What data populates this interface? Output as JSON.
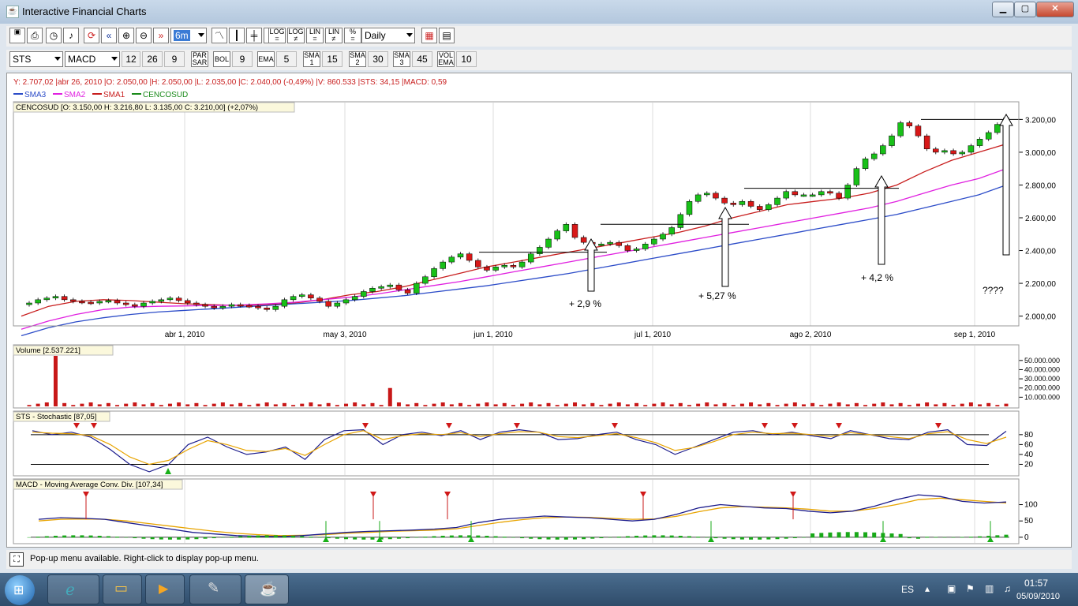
{
  "window": {
    "title": "Interactive Financial Charts",
    "app_icon": "java-icon",
    "controls": [
      "minimize-icon",
      "maximize-icon",
      "close-icon"
    ]
  },
  "toolbar1": {
    "period_value": "6m",
    "log_labels": [
      "LOG\n=",
      "LOG\n≠",
      "LIN\n=",
      "LIN\n≠",
      "%\n="
    ],
    "interval_value": "Daily"
  },
  "toolbar2": {
    "symbol": "STS",
    "indicator": "MACD",
    "macd_params": [
      "12",
      "26",
      "9"
    ],
    "par_sar_label": "PAR\nSAR",
    "bol_label": "BOL",
    "bol_value": "9",
    "ema_label": "EMA",
    "ema_value": "5",
    "sma1_label": "SMA\n1",
    "sma1_value": "15",
    "sma2_label": "SMA\n2",
    "sma2_value": "30",
    "sma3_label": "SMA\n3",
    "sma3_value": "45",
    "vol_label": "VOL\nEMA",
    "vol_value": "10"
  },
  "chart": {
    "info_line": "Y: 2.707,02 |abr 26, 2010 |O: 2.050,00 |H: 2.050,00 |L: 2.035,00 |C: 2.040,00 (-0,49%) |V: 860.533 |STS: 34,15 |MACD: 0,59",
    "legend": [
      {
        "name": "SMA3",
        "color": "#2c4cc8"
      },
      {
        "name": "SMA2",
        "color": "#e020e0"
      },
      {
        "name": "SMA1",
        "color": "#c81e1e"
      },
      {
        "name": "CENCOSUD",
        "color": "#1a8a1a"
      }
    ],
    "ohlc_label": "CENCOSUD [O: 3.150,00  H: 3.216,80  L: 3.135,00  C: 3.210,00] (+2,07%)",
    "volume_label": "Volume [2.537.221]",
    "sts_label": "STS - Stochastic [87,05]",
    "macd_label": "MACD - Moving Average Conv. Div. [107,34]",
    "annotations": [
      "+ 2,9 %",
      "+ 5,27 %",
      "+ 4,2 %",
      "????"
    ]
  },
  "chart_data": [
    {
      "type": "candlestick",
      "title": "CENCOSUD [O: 3.150,00  H: 3.216,80  L: 3.135,00  C: 3.210,00] (+2,07%)",
      "ylim": [
        1950,
        3250
      ],
      "x_ticks": [
        "abr 1, 2010",
        "may 3, 2010",
        "jun 1, 2010",
        "jul 1, 2010",
        "ago 2, 2010",
        "sep 1, 2010"
      ],
      "y_ticks": [
        "3.200,00",
        "3.000,00",
        "2.800,00",
        "2.600,00",
        "2.400,00",
        "2.200,00",
        "2.000,00"
      ],
      "close_series": [
        2080,
        2100,
        2110,
        2120,
        2100,
        2090,
        2085,
        2080,
        2090,
        2095,
        2080,
        2070,
        2060,
        2080,
        2090,
        2100,
        2110,
        2095,
        2080,
        2070,
        2060,
        2050,
        2060,
        2070,
        2065,
        2060,
        2050,
        2040,
        2060,
        2100,
        2120,
        2130,
        2110,
        2090,
        2060,
        2080,
        2100,
        2120,
        2150,
        2170,
        2180,
        2190,
        2160,
        2140,
        2200,
        2240,
        2290,
        2330,
        2360,
        2380,
        2340,
        2300,
        2280,
        2300,
        2310,
        2300,
        2330,
        2380,
        2420,
        2470,
        2520,
        2560,
        2480,
        2450,
        2440,
        2440,
        2450,
        2430,
        2400,
        2410,
        2440,
        2470,
        2500,
        2540,
        2620,
        2700,
        2740,
        2750,
        2720,
        2690,
        2680,
        2700,
        2670,
        2650,
        2680,
        2720,
        2760,
        2740,
        2740,
        2740,
        2760,
        2750,
        2720,
        2800,
        2900,
        2960,
        2990,
        3040,
        3100,
        3180,
        3160,
        3100,
        3020,
        3000,
        3010,
        2990,
        3000,
        3040,
        3080,
        3120,
        3170,
        3210
      ],
      "series": [
        {
          "name": "SMA1",
          "color": "#c81e1e",
          "values": [
            2000,
            2060,
            2090,
            2100,
            2095,
            2085,
            2075,
            2070,
            2065,
            2070,
            2080,
            2100,
            2130,
            2150,
            2180,
            2220,
            2260,
            2300,
            2330,
            2360,
            2390,
            2420,
            2450,
            2480,
            2510,
            2550,
            2600,
            2640,
            2680,
            2700,
            2720,
            2750,
            2800,
            2880,
            2950,
            3000,
            3050
          ]
        },
        {
          "name": "SMA2",
          "color": "#e020e0",
          "values": [
            1920,
            1970,
            2010,
            2040,
            2055,
            2060,
            2062,
            2065,
            2068,
            2075,
            2085,
            2100,
            2115,
            2135,
            2160,
            2185,
            2210,
            2240,
            2270,
            2300,
            2330,
            2360,
            2390,
            2420,
            2450,
            2480,
            2510,
            2540,
            2570,
            2600,
            2630,
            2660,
            2700,
            2750,
            2800,
            2840,
            2900
          ]
        },
        {
          "name": "SMA3",
          "color": "#2c4cc8",
          "values": [
            1880,
            1930,
            1965,
            1990,
            2010,
            2025,
            2035,
            2045,
            2055,
            2065,
            2075,
            2085,
            2095,
            2110,
            2125,
            2145,
            2165,
            2185,
            2210,
            2235,
            2260,
            2290,
            2320,
            2350,
            2380,
            2410,
            2440,
            2470,
            2500,
            2530,
            2560,
            2590,
            2620,
            2660,
            2700,
            2740,
            2800
          ]
        }
      ]
    },
    {
      "type": "bar",
      "title": "Volume [2.537.221]",
      "y_ticks": [
        "50.000.000",
        "40.000.000",
        "30.000.000",
        "20.000.000",
        "10.000.000"
      ],
      "ylim": [
        0,
        55000000
      ]
    },
    {
      "type": "line",
      "title": "STS - Stochastic [87,05]",
      "y_ticks": [
        "80",
        "60",
        "40",
        "20"
      ],
      "ylim": [
        0,
        100
      ],
      "series": [
        {
          "name": "%K",
          "color": "#1c1c8c",
          "values": [
            88,
            80,
            85,
            75,
            50,
            20,
            5,
            20,
            60,
            75,
            55,
            40,
            45,
            55,
            30,
            70,
            88,
            90,
            60,
            80,
            85,
            78,
            88,
            70,
            85,
            90,
            85,
            70,
            72,
            80,
            85,
            70,
            60,
            40,
            55,
            70,
            85,
            88,
            80,
            85,
            78,
            72,
            88,
            80,
            72,
            70,
            85,
            90,
            60,
            58,
            87
          ]
        },
        {
          "name": "%D",
          "color": "#e8a400",
          "values": [
            85,
            83,
            82,
            78,
            60,
            35,
            20,
            28,
            50,
            68,
            60,
            48,
            46,
            52,
            38,
            60,
            80,
            88,
            70,
            78,
            82,
            80,
            84,
            76,
            82,
            86,
            85,
            76,
            74,
            78,
            82,
            74,
            64,
            48,
            54,
            66,
            80,
            85,
            82,
            83,
            80,
            76,
            84,
            80,
            76,
            72,
            82,
            86,
            70,
            62,
            75
          ]
        }
      ]
    },
    {
      "type": "line",
      "title": "MACD - Moving Average Conv. Div. [107,34]",
      "y_ticks": [
        "100",
        "50",
        "0"
      ],
      "ylim": [
        -10,
        140
      ]
    }
  ]
}
